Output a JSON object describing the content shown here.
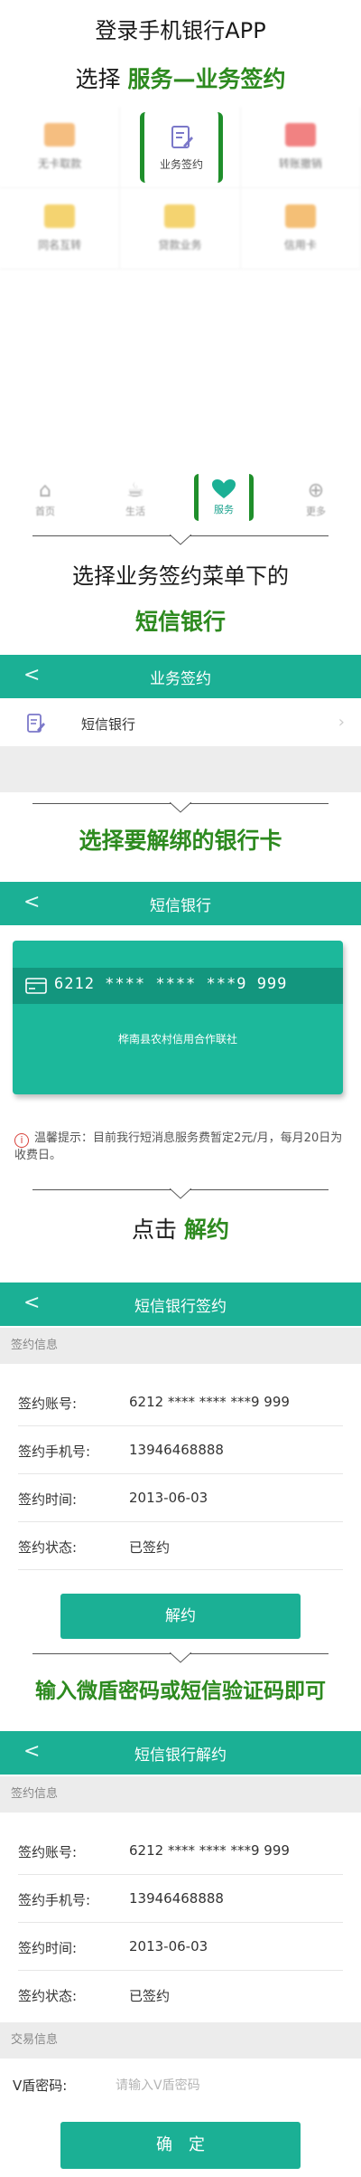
{
  "step1": {
    "title": "登录手机银行APP",
    "subtitle_prefix": "选择",
    "subtitle_highlight": "服务—业务签约"
  },
  "service_grid": [
    {
      "label": "无卡取款",
      "color": "#f4b36b"
    },
    {
      "label": "业务签约",
      "color": "#ffffff"
    },
    {
      "label": "转账撤销",
      "color": "#ef6d6d"
    },
    {
      "label": "同名互转",
      "color": "#f3cc58"
    },
    {
      "label": "贷款业务",
      "color": "#f3cc58"
    },
    {
      "label": "信用卡",
      "color": "#f3b45f"
    }
  ],
  "tabbar": [
    {
      "label": "首页",
      "icon": "home-icon"
    },
    {
      "label": "生活",
      "icon": "coffee-icon"
    },
    {
      "label": "服务",
      "icon": "heart-icon"
    },
    {
      "label": "更多",
      "icon": "plus-circle-icon"
    }
  ],
  "step2": {
    "line1": "选择业务签约菜单下的",
    "line2": "短信银行"
  },
  "screen_signing": {
    "title": "业务签约",
    "item": "短信银行"
  },
  "step3": {
    "title": "选择要解绑的银行卡"
  },
  "screen_sms": {
    "title": "短信银行",
    "card_number": "6212 **** **** ***9 999",
    "bank_name": "桦南县农村信用合作联社",
    "tip_label": "温馨提示：",
    "tip_text": "目前我行短消息服务费暂定2元/月，每月20日为收费日。"
  },
  "step4": {
    "prefix": "点击",
    "highlight": "解约"
  },
  "screen_sign_detail": {
    "title": "短信银行签约",
    "section": "签约信息",
    "rows": [
      {
        "k": "签约账号:",
        "v": "6212 **** **** ***9 999"
      },
      {
        "k": "签约手机号:",
        "v": "13946468888"
      },
      {
        "k": "签约时间:",
        "v": "2013-06-03"
      },
      {
        "k": "签约状态:",
        "v": "已签约"
      }
    ],
    "button": "解约"
  },
  "step5": {
    "title": "输入微盾密码或短信验证码即可"
  },
  "screen_cancel": {
    "title": "短信银行解约",
    "section": "签约信息",
    "rows": [
      {
        "k": "签约账号:",
        "v": "6212 **** **** ***9 999"
      },
      {
        "k": "签约手机号:",
        "v": "13946468888"
      },
      {
        "k": "签约时间:",
        "v": "2013-06-03"
      },
      {
        "k": "签约状态:",
        "v": "已签约"
      }
    ],
    "section2": "交易信息",
    "pwd_label": "V盾密码:",
    "pwd_placeholder": "请输入V盾密码",
    "button": "确　定"
  },
  "colors": {
    "teal": "#1bb095",
    "green_text": "#2d8a1f",
    "bracket": "#1f8f2b"
  }
}
